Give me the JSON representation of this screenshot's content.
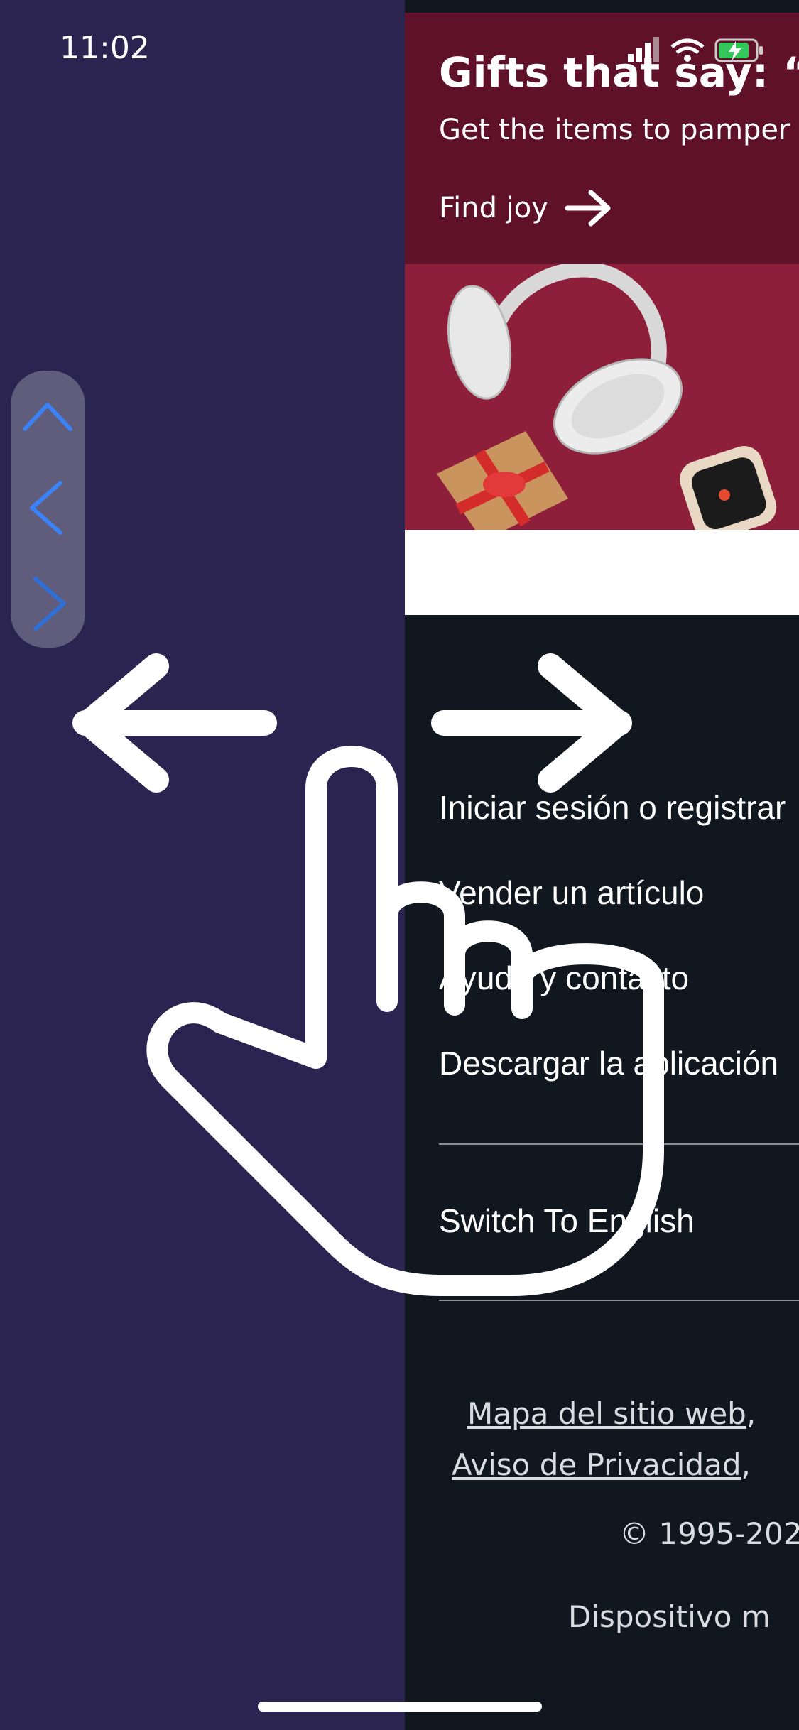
{
  "status_bar": {
    "time": "11:02"
  },
  "promo": {
    "title": "Gifts that say: “W",
    "subtitle": "Get the items to pamper",
    "link_label": "Find joy"
  },
  "menu": {
    "items": [
      "Iniciar sesión o registrar",
      "Vender un artículo",
      "Ayuda y contacto",
      "Descargar la aplicación"
    ],
    "language_switch": "Switch To English"
  },
  "footer": {
    "sitemap_link": "Mapa del sitio web",
    "privacy_link": "Aviso de Privacidad",
    "separator": ",",
    "copyright": "© 1995-202",
    "device_text": "Dispositivo m"
  },
  "colors": {
    "left_bg": "#2b2350",
    "footer_bg": "#11171f",
    "promo_bg": "#5e1129",
    "nav_arrow": "#3b82f6"
  },
  "icons": [
    "signal-icon",
    "wifi-icon",
    "battery-charging-icon",
    "up-chevron-icon",
    "left-chevron-icon",
    "right-chevron-icon",
    "arrow-right-icon",
    "swipe-left-arrow-icon",
    "swipe-right-arrow-icon",
    "hand-pointer-icon"
  ]
}
